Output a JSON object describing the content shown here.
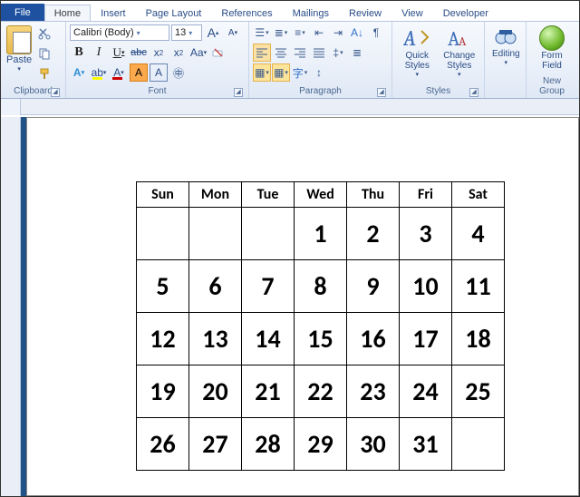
{
  "tabs": {
    "file": "File",
    "items": [
      "Home",
      "Insert",
      "Page Layout",
      "References",
      "Mailings",
      "Review",
      "View",
      "Developer"
    ],
    "active_index": 0
  },
  "ribbon": {
    "clipboard": {
      "label": "Clipboard",
      "paste": "Paste"
    },
    "font": {
      "label": "Font",
      "name": "Calibri (Body)",
      "size": "13",
      "bold": "B",
      "italic": "I",
      "underline": "U",
      "strike": "abc",
      "sub": "x",
      "sup": "x",
      "grow": "A",
      "shrink": "A",
      "case": "Aa",
      "highlight": "ab",
      "fontcolor": "A",
      "charbox": "A"
    },
    "paragraph": {
      "label": "Paragraph"
    },
    "styles": {
      "label": "Styles",
      "quick": "Quick Styles",
      "change": "Change Styles"
    },
    "editing": {
      "label": "",
      "find": "Editing"
    },
    "newgroup": {
      "label": "New Group",
      "btn": "Form Field"
    }
  },
  "calendar": {
    "headers": [
      "Sun",
      "Mon",
      "Tue",
      "Wed",
      "Thu",
      "Fri",
      "Sat"
    ],
    "rows": [
      [
        "",
        "",
        "",
        "1",
        "2",
        "3",
        "4"
      ],
      [
        "5",
        "6",
        "7",
        "8",
        "9",
        "10",
        "11"
      ],
      [
        "12",
        "13",
        "14",
        "15",
        "16",
        "17",
        "18"
      ],
      [
        "19",
        "20",
        "21",
        "22",
        "23",
        "24",
        "25"
      ],
      [
        "26",
        "27",
        "28",
        "29",
        "30",
        "31",
        ""
      ]
    ]
  }
}
